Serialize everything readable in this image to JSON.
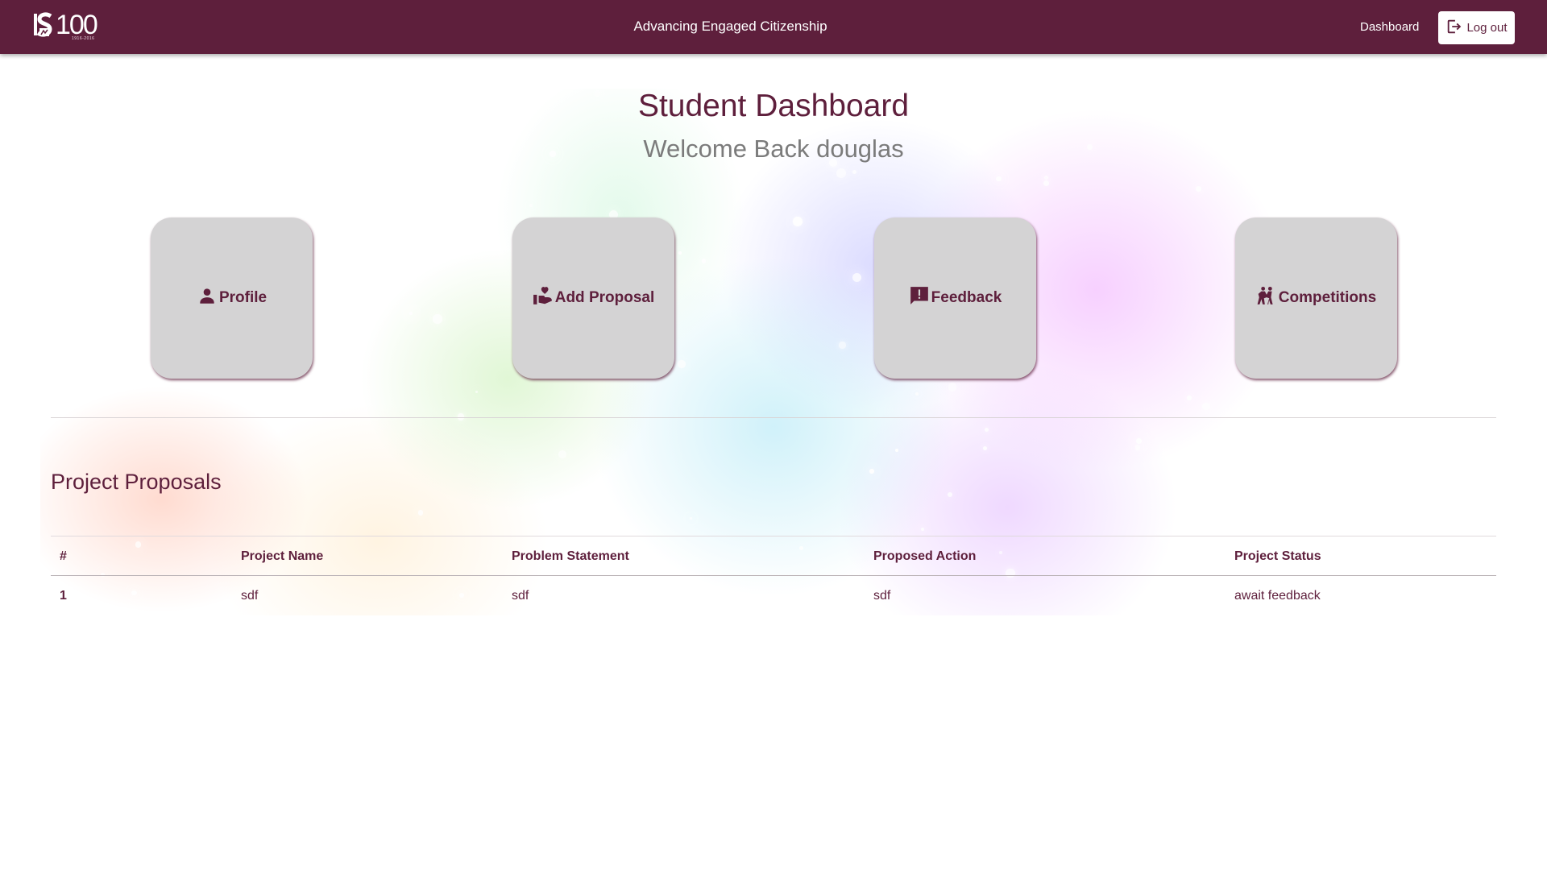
{
  "header": {
    "logo_text": "100",
    "logo_years": "1916-2016",
    "tagline": "Advancing Engaged Citizenship",
    "nav_dashboard": "Dashboard",
    "logout_label": "Log out",
    "brand_color": "#5e1f3c"
  },
  "main": {
    "title": "Student Dashboard",
    "welcome": "Welcome Back douglas"
  },
  "tiles": [
    {
      "label": "Profile",
      "icon": "person-icon"
    },
    {
      "label": "Add Proposal",
      "icon": "hand-heart-icon"
    },
    {
      "label": "Feedback",
      "icon": "feedback-icon"
    },
    {
      "label": "Competitions",
      "icon": "sports-icon"
    }
  ],
  "proposals": {
    "heading": "Project Proposals",
    "columns": [
      "#",
      "Project Name",
      "Problem Statement",
      "Proposed Action",
      "Project Status"
    ],
    "rows": [
      [
        "1",
        "sdf",
        "sdf",
        "sdf",
        "await feedback"
      ]
    ]
  }
}
